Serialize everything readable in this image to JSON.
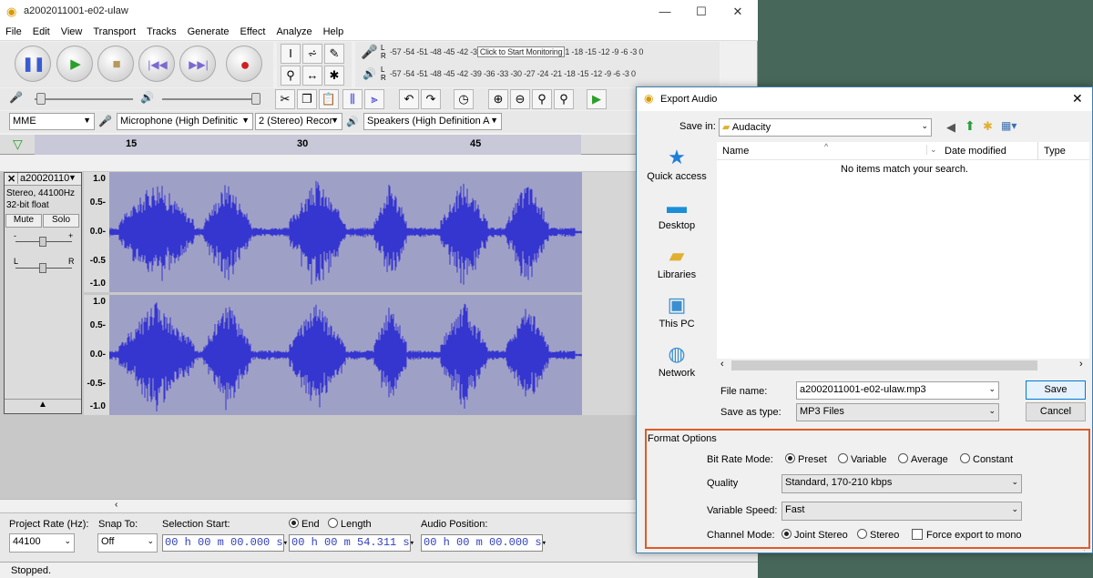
{
  "app": {
    "title": "a2002011001-e02-ulaw",
    "menu": [
      "File",
      "Edit",
      "View",
      "Transport",
      "Tracks",
      "Generate",
      "Effect",
      "Analyze",
      "Help"
    ]
  },
  "meters": {
    "record_scale": "-57 -54 -51 -48 -45 -42 -3",
    "monitor_hint": "Click to Start Monitoring",
    "record_scale_tail": "1 -18 -15 -12 -9 -6 -3 0",
    "play_scale": "-57 -54 -51 -48 -45 -42 -39 -36 -33 -30 -27 -24 -21 -18 -15 -12 -9 -6 -3 0",
    "lr_top": "L R",
    "lr_bottom": "L R"
  },
  "device": {
    "host": "MME",
    "mic": "Microphone (High Definitic",
    "channels": "2 (Stereo) Recor",
    "speakers": "Speakers (High Definition A"
  },
  "ruler": [
    "15",
    "30",
    "45"
  ],
  "track": {
    "name": "a20020110",
    "info1": "Stereo, 44100Hz",
    "info2": "32-bit float",
    "mute": "Mute",
    "solo": "Solo",
    "gain_minus": "-",
    "gain_plus": "+",
    "pan_l": "L",
    "pan_r": "R",
    "scale_top": [
      "1.0",
      "0.5-",
      "0.0-",
      "-0.5",
      "-1.0"
    ],
    "scale_bottom": [
      "1.0",
      "0.5-",
      "0.0-",
      "-0.5-",
      "-1.0"
    ]
  },
  "bottom": {
    "rate_label": "Project Rate (Hz):",
    "rate_value": "44100",
    "snap_label": "Snap To:",
    "snap_value": "Off",
    "sel_start_label": "Selection Start:",
    "end_label": "End",
    "length_label": "Length",
    "audio_pos_label": "Audio Position:",
    "sel_start": "00 h 00 m 00.000 s",
    "sel_end": "00 h 00 m 54.311 s",
    "audio_pos": "00 h 00 m 00.000 s"
  },
  "status": "Stopped.",
  "dialog": {
    "title": "Export Audio",
    "save_in_label": "Save in:",
    "save_in_value": "Audacity",
    "places": [
      "Quick access",
      "Desktop",
      "Libraries",
      "This PC",
      "Network"
    ],
    "col_name": "Name",
    "col_date": "Date modified",
    "col_type": "Type",
    "empty_msg": "No items match your search.",
    "file_name_label": "File name:",
    "file_name_value": "a2002011001-e02-ulaw.mp3",
    "save_type_label": "Save as type:",
    "save_type_value": "MP3 Files",
    "save_btn": "Save",
    "cancel_btn": "Cancel",
    "format_title": "Format Options",
    "bitrate_label": "Bit Rate Mode:",
    "bitrate_opts": [
      "Preset",
      "Variable",
      "Average",
      "Constant"
    ],
    "quality_label": "Quality",
    "quality_value": "Standard, 170-210 kbps",
    "varspeed_label": "Variable Speed:",
    "varspeed_value": "Fast",
    "channel_label": "Channel Mode:",
    "channel_opts": [
      "Joint Stereo",
      "Stereo"
    ],
    "force_mono": "Force export to mono"
  },
  "colors": {
    "wave": "#3535d0",
    "wave_bg": "#9fa0c6",
    "highlight": "#e05a27",
    "desktop": "#466759"
  }
}
